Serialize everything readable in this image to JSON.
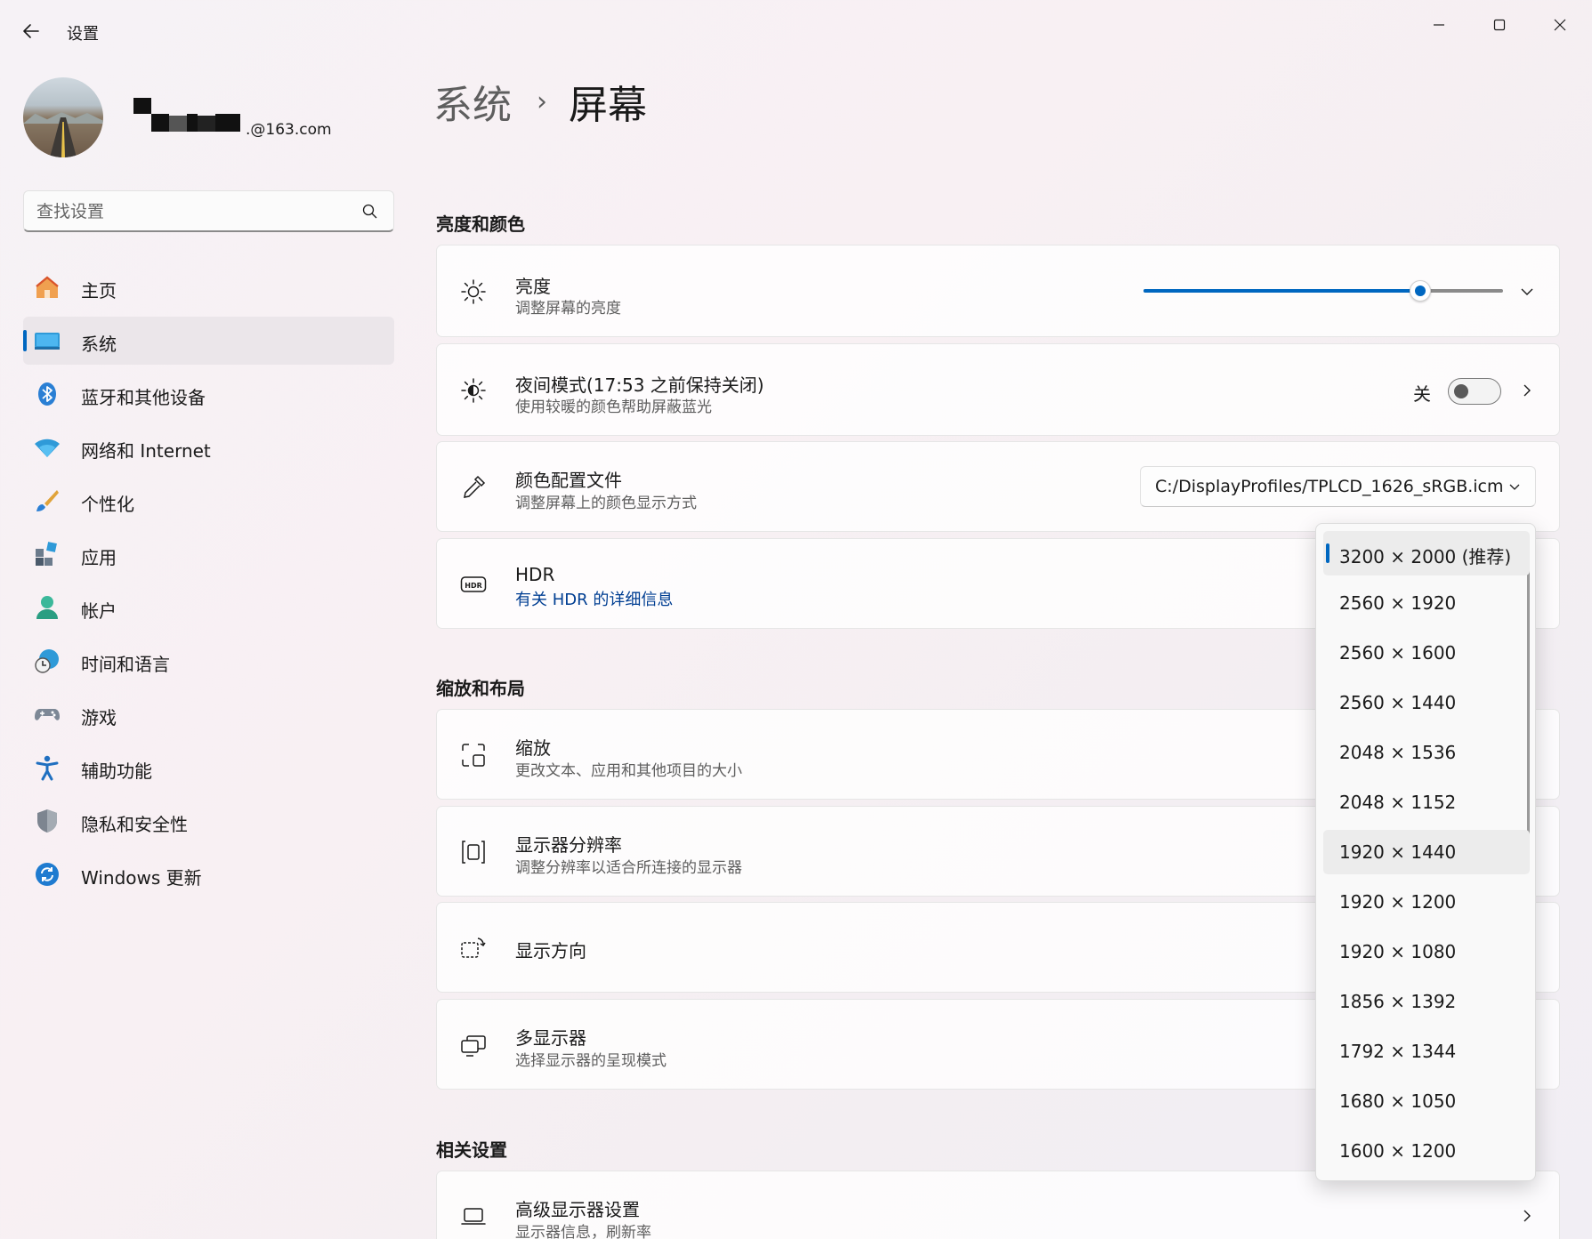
{
  "window": {
    "title": "设置",
    "back_icon": "arrow-left-icon",
    "controls": [
      "minimize-icon",
      "maximize-icon",
      "close-icon"
    ]
  },
  "profile": {
    "email": ".@163.com"
  },
  "search": {
    "placeholder": "查找设置"
  },
  "sidebar": {
    "items": [
      {
        "label": "主页",
        "icon": "home-icon",
        "active": false
      },
      {
        "label": "系统",
        "icon": "system-icon",
        "active": true
      },
      {
        "label": "蓝牙和其他设备",
        "icon": "bluetooth-icon",
        "active": false
      },
      {
        "label": "网络和 Internet",
        "icon": "wifi-icon",
        "active": false
      },
      {
        "label": "个性化",
        "icon": "brush-icon",
        "active": false
      },
      {
        "label": "应用",
        "icon": "apps-icon",
        "active": false
      },
      {
        "label": "帐户",
        "icon": "account-icon",
        "active": false
      },
      {
        "label": "时间和语言",
        "icon": "clock-globe-icon",
        "active": false
      },
      {
        "label": "游戏",
        "icon": "gamepad-icon",
        "active": false
      },
      {
        "label": "辅助功能",
        "icon": "accessibility-icon",
        "active": false
      },
      {
        "label": "隐私和安全性",
        "icon": "shield-icon",
        "active": false
      },
      {
        "label": "Windows 更新",
        "icon": "update-icon",
        "active": false
      }
    ]
  },
  "breadcrumb": {
    "parent": "系统",
    "separator": "›",
    "current": "屏幕"
  },
  "sections": {
    "brightness_color": "亮度和颜色",
    "scale_layout": "缩放和布局",
    "related": "相关设置"
  },
  "cards": {
    "brightness": {
      "title": "亮度",
      "subtitle": "调整屏幕的亮度",
      "value": 77
    },
    "night_mode": {
      "title": "夜间模式(17:53 之前保持关闭)",
      "subtitle": "使用较暖的颜色帮助屏蔽蓝光",
      "toggle_label": "关",
      "on": false
    },
    "color_profile": {
      "title": "颜色配置文件",
      "subtitle": "调整屏幕上的颜色显示方式",
      "selected": "C:/DisplayProfiles/TPLCD_1626_sRGB.icm"
    },
    "hdr": {
      "title": "HDR",
      "link": "有关 HDR 的详细信息"
    },
    "scale": {
      "title": "缩放",
      "subtitle": "更改文本、应用和其他项目的大小"
    },
    "resolution": {
      "title": "显示器分辨率",
      "subtitle": "调整分辨率以适合所连接的显示器"
    },
    "orientation": {
      "title": "显示方向"
    },
    "multi_display": {
      "title": "多显示器",
      "subtitle": "选择显示器的呈现模式"
    },
    "advanced": {
      "title": "高级显示器设置",
      "subtitle": "显示器信息，刷新率"
    }
  },
  "resolution_dropdown": {
    "options": [
      "3200 × 2000 (推荐)",
      "2560 × 1920",
      "2560 × 1600",
      "2560 × 1440",
      "2048 × 1536",
      "2048 × 1152",
      "1920 × 1440",
      "1920 × 1200",
      "1920 × 1080",
      "1856 × 1392",
      "1792 × 1344",
      "1680 × 1050",
      "1600 × 1200"
    ],
    "selected_index": 0,
    "hover_index": 6
  },
  "colors": {
    "accent": "#0067c0",
    "link": "#003e92"
  }
}
